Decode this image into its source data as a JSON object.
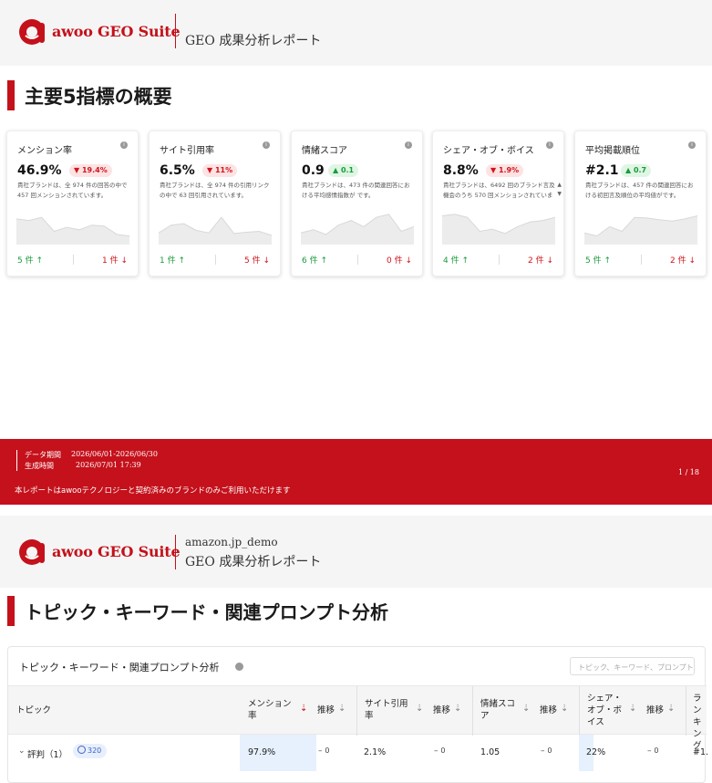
{
  "brand": {
    "logo_text": "awoo GEO Suite",
    "color": "#c4111b"
  },
  "page1": {
    "header_title": "GEO 成果分析レポート",
    "section_title": "主要5指標の概要",
    "cards": [
      {
        "title": "メンション率",
        "value": "46.9%",
        "change": "19.4%",
        "direction": "down",
        "desc": "貴社ブランドは、全 974 件の回答の中で 457 回メンションされています。",
        "up_count": "5 件",
        "down_count": "1 件",
        "spark": [
          0.35,
          0.4,
          0.3,
          0.75,
          0.62,
          0.7,
          0.55,
          0.58,
          0.85,
          0.9
        ]
      },
      {
        "title": "サイト引用率",
        "value": "6.5%",
        "change": "11%",
        "direction": "down",
        "desc": "貴社ブランドは、全 974 件の引用リンクの中で 63 回引用されています。",
        "up_count": "1 件",
        "down_count": "5 件",
        "spark": [
          0.8,
          0.55,
          0.5,
          0.72,
          0.8,
          0.3,
          0.82,
          0.78,
          0.75,
          0.88
        ]
      },
      {
        "title": "情緒スコア",
        "value": "0.9",
        "change": "0.1",
        "direction": "up",
        "desc": "貴社ブランドは、473 件の関連回答における平均感情指数が です。",
        "up_count": "6 件",
        "down_count": "0 件",
        "spark": [
          0.8,
          0.7,
          0.85,
          0.55,
          0.4,
          0.6,
          0.3,
          0.2,
          0.75,
          0.6
        ]
      },
      {
        "title": "シェア・オブ・ボイス",
        "value": "8.8%",
        "change": "1.9%",
        "direction": "down",
        "desc": "貴社ブランドは、6492 回のブランド言及機会のうち 570 回メンションされています。",
        "up_count": "4 件",
        "down_count": "2 件",
        "spark": [
          0.25,
          0.2,
          0.3,
          0.75,
          0.68,
          0.82,
          0.6,
          0.45,
          0.4,
          0.3
        ]
      },
      {
        "title": "平均掲載順位",
        "value": "#2.1",
        "change": "0.7",
        "direction": "up",
        "desc": "貴社ブランドは、457 件の関連回答における初回言及順位の平均値がです。",
        "up_count": "5 件",
        "down_count": "2 件",
        "spark": [
          0.8,
          0.9,
          0.6,
          0.75,
          0.3,
          0.32,
          0.38,
          0.42,
          0.35,
          0.25
        ]
      }
    ],
    "footer": {
      "period_label": "データ期間",
      "period_value": "2026/06/01-2026/06/30",
      "generated_label": "生成時間",
      "generated_value": "2026/07/01 17:39",
      "page": "1 / 18",
      "note": "本レポートはawooテクノロジーと契約済みのブランドのみご利用いただけます"
    }
  },
  "page2": {
    "account": "amazon.jp_demo",
    "header_title": "GEO 成果分析レポート",
    "section_title": "トピック・キーワード・関連プロンプト分析",
    "panel_title": "トピック・キーワード・関連プロンプト分析",
    "search_placeholder": "トピック、キーワード、プロンプト",
    "columns": {
      "topic": "トピック",
      "mention_1": "メンション",
      "mention_2": "率",
      "trend": "推移",
      "cite_1": "サイト引用",
      "cite_2": "率",
      "sent_1": "情緒スコ",
      "sent_2": "ア",
      "sov_1": "シェア・",
      "sov_2": "オブ・ボ",
      "sov_3": "イス",
      "rank_1": "ラン",
      "rank_2": "キン",
      "rank_3": "グ"
    },
    "row": {
      "topic": "評判（1）",
      "count": "320",
      "mention": "97.9%",
      "mention_trend": "0",
      "cite": "2.1%",
      "cite_trend": "0",
      "sentiment": "1.05",
      "sentiment_trend": "0",
      "sov": "22%",
      "sov_trend": "0",
      "rank": "#1."
    }
  }
}
